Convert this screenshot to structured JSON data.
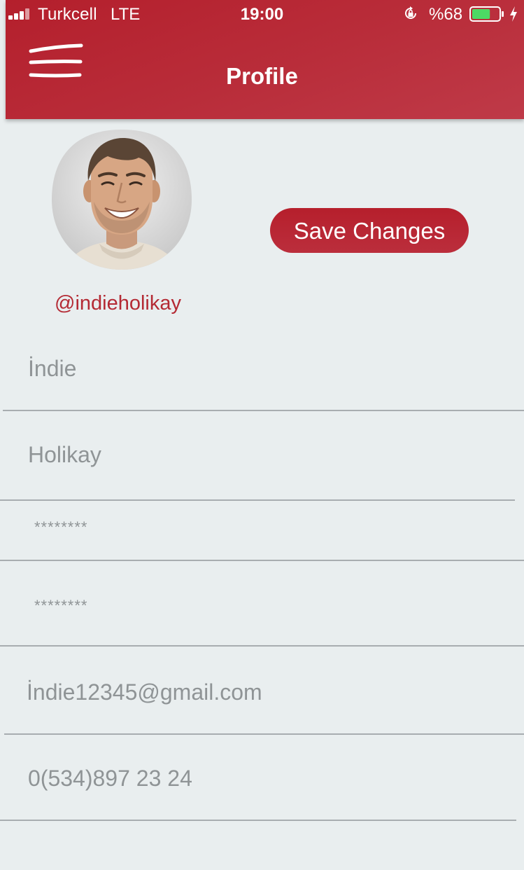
{
  "status_bar": {
    "carrier": "Turkcell",
    "network": "LTE",
    "time": "19:00",
    "battery_percent": "%68",
    "battery_level": 0.68
  },
  "header": {
    "title": "Profile",
    "menu_icon": "hamburger-menu-icon",
    "background_color": "#b41f2c"
  },
  "profile": {
    "username": "@indieholikay",
    "save_button_label": "Save Changes",
    "avatar_alt": "avatar"
  },
  "form": {
    "first_name": "İndie",
    "last_name": "Holikay",
    "password": "********",
    "password_confirm": "********",
    "email": "İndie12345@gmail.com",
    "phone": "0(534)897 23 24"
  },
  "colors": {
    "accent": "#b41f2c",
    "username_text": "#b42a34",
    "field_text": "#8f9496",
    "background": "#e9eeef",
    "battery_fill": "#4cd964"
  }
}
